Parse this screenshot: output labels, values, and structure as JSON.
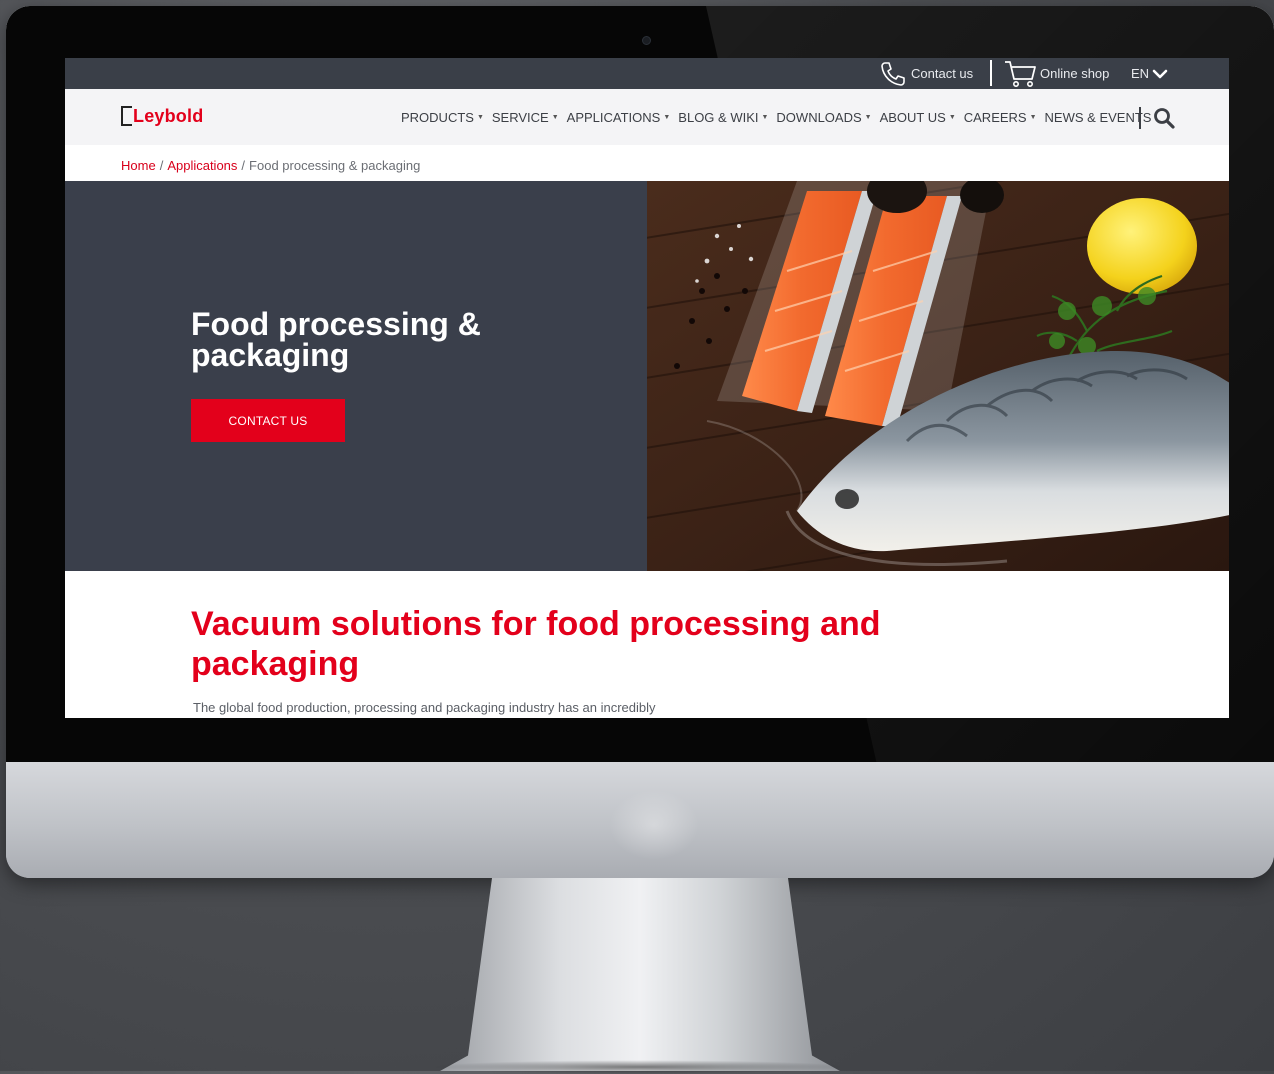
{
  "topbar": {
    "contact": "Contact us",
    "shop": "Online shop",
    "language": "EN"
  },
  "brand": {
    "logo_text": "Leybold",
    "accent": "#e3001b"
  },
  "nav": {
    "products": "PRODUCTS",
    "service": "SERVICE",
    "applications": "APPLICATIONS",
    "blog": "BLOG & WIKI",
    "downloads": "DOWNLOADS",
    "about": "ABOUT US",
    "careers": "CAREERS",
    "news": "NEWS & EVENTS"
  },
  "breadcrumb": {
    "home": "Home",
    "applications": "Applications",
    "current": "Food processing & packaging"
  },
  "hero": {
    "title": "Food processing & packaging",
    "cta": "CONTACT US"
  },
  "section": {
    "title": "Vacuum solutions for food processing and packaging",
    "body": "The global food production, processing and packaging industry has an incredibly"
  },
  "colors": {
    "topbar": "#3a3f48",
    "hero_panel": "#3a3f4b",
    "navbar": "#f4f4f6"
  }
}
